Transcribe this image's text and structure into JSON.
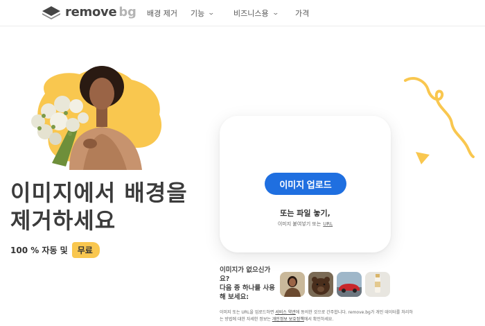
{
  "header": {
    "logo": {
      "word": "remove",
      "suffix": "bg"
    },
    "nav": [
      {
        "label": "배경 제거",
        "has_dropdown": false
      },
      {
        "label": "기능",
        "has_dropdown": true
      },
      {
        "label": "비즈니스용",
        "has_dropdown": true
      },
      {
        "label": "가격",
        "has_dropdown": false
      }
    ]
  },
  "hero": {
    "headline_line1": "이미지에서 배경을",
    "headline_line2": "제거하세요",
    "subline": "100 % 자동 및",
    "badge": "무료"
  },
  "upload": {
    "button_label": "이미지 업로드",
    "drop_text": "또는 파일 놓기,",
    "paste_text": "이미지 붙여넣기 또는",
    "paste_link": "URL"
  },
  "samples": {
    "prompt_line1": "이미지가 없으신가",
    "prompt_line2": "요?",
    "prompt_line3": "다음 중 하나를 사용",
    "prompt_line4": "해 보세요:",
    "thumbnails": [
      "woman-photo",
      "bear-photo",
      "car-photo",
      "bottle-photo"
    ]
  },
  "legal": {
    "part1": "이미지 또는 URL을 업로드하면 ",
    "terms_link": "서비스 약관",
    "part2": "에 동의한 것으로 간주합니다. remove.bg가 개인 데이터를 처리하는 방법에 대한 자세한 정보는 ",
    "privacy_link": "개인정보 보호정책",
    "part3": "에서 확인하세요."
  },
  "colors": {
    "accent_blue": "#1f6fe0",
    "accent_yellow": "#f9c74f",
    "text_dark": "#3b3b3b"
  }
}
